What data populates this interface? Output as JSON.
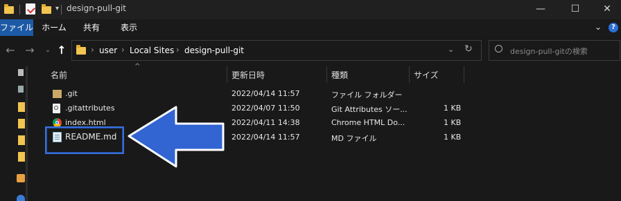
{
  "window": {
    "title": "design-pull-git",
    "controls": {
      "minimize": "—",
      "maximize": "☐",
      "close": "✕"
    }
  },
  "menu": {
    "file": "ファイル",
    "home": "ホーム",
    "share": "共有",
    "view": "表示"
  },
  "address": {
    "crumbs": [
      "user",
      "Local Sites",
      "design-pull-git"
    ],
    "chevron": "›"
  },
  "search": {
    "placeholder": "design-pull-gitの検索"
  },
  "columns": {
    "name": "名前",
    "modified": "更新日時",
    "type": "種類",
    "size": "サイズ"
  },
  "files": [
    {
      "name": ".git",
      "modified": "2022/04/14 11:57",
      "type": "ファイル フォルダー",
      "size": "",
      "icon": "folder-icon"
    },
    {
      "name": ".gitattributes",
      "modified": "2022/04/07 11:50",
      "type": "Git Attributes ソー...",
      "size": "1 KB",
      "icon": "gear-file-icon"
    },
    {
      "name": "index.html",
      "modified": "2022/04/11 14:38",
      "type": "Chrome HTML Do...",
      "size": "1 KB",
      "icon": "chrome-icon"
    },
    {
      "name": "README.md",
      "modified": "2022/04/14 11:57",
      "type": "MD ファイル",
      "size": "1 KB",
      "icon": "notepad-icon"
    }
  ],
  "colors": {
    "accent": "#1d5aa6",
    "arrow": "#3264d2",
    "highlight": "#3a6fd9"
  }
}
